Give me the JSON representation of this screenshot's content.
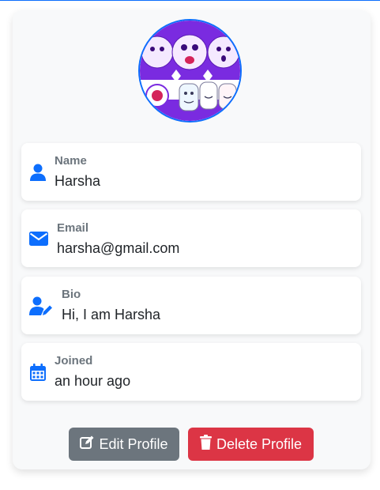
{
  "profile": {
    "fields": {
      "name": {
        "label": "Name",
        "value": "Harsha",
        "icon": "user-icon"
      },
      "email": {
        "label": "Email",
        "value": "harsha@gmail.com",
        "icon": "envelope-icon"
      },
      "bio": {
        "label": "Bio",
        "value": "Hi, I am Harsha",
        "icon": "user-edit-icon"
      },
      "joined": {
        "label": "Joined",
        "value": "an hour ago",
        "icon": "calendar-icon"
      }
    },
    "actions": {
      "edit_label": "Edit Profile",
      "delete_label": "Delete Profile"
    }
  },
  "colors": {
    "accent": "#0d6efd",
    "edit_button": "#6c757d",
    "delete_button": "#dc3545",
    "card_bg": "#f8f9fa"
  }
}
